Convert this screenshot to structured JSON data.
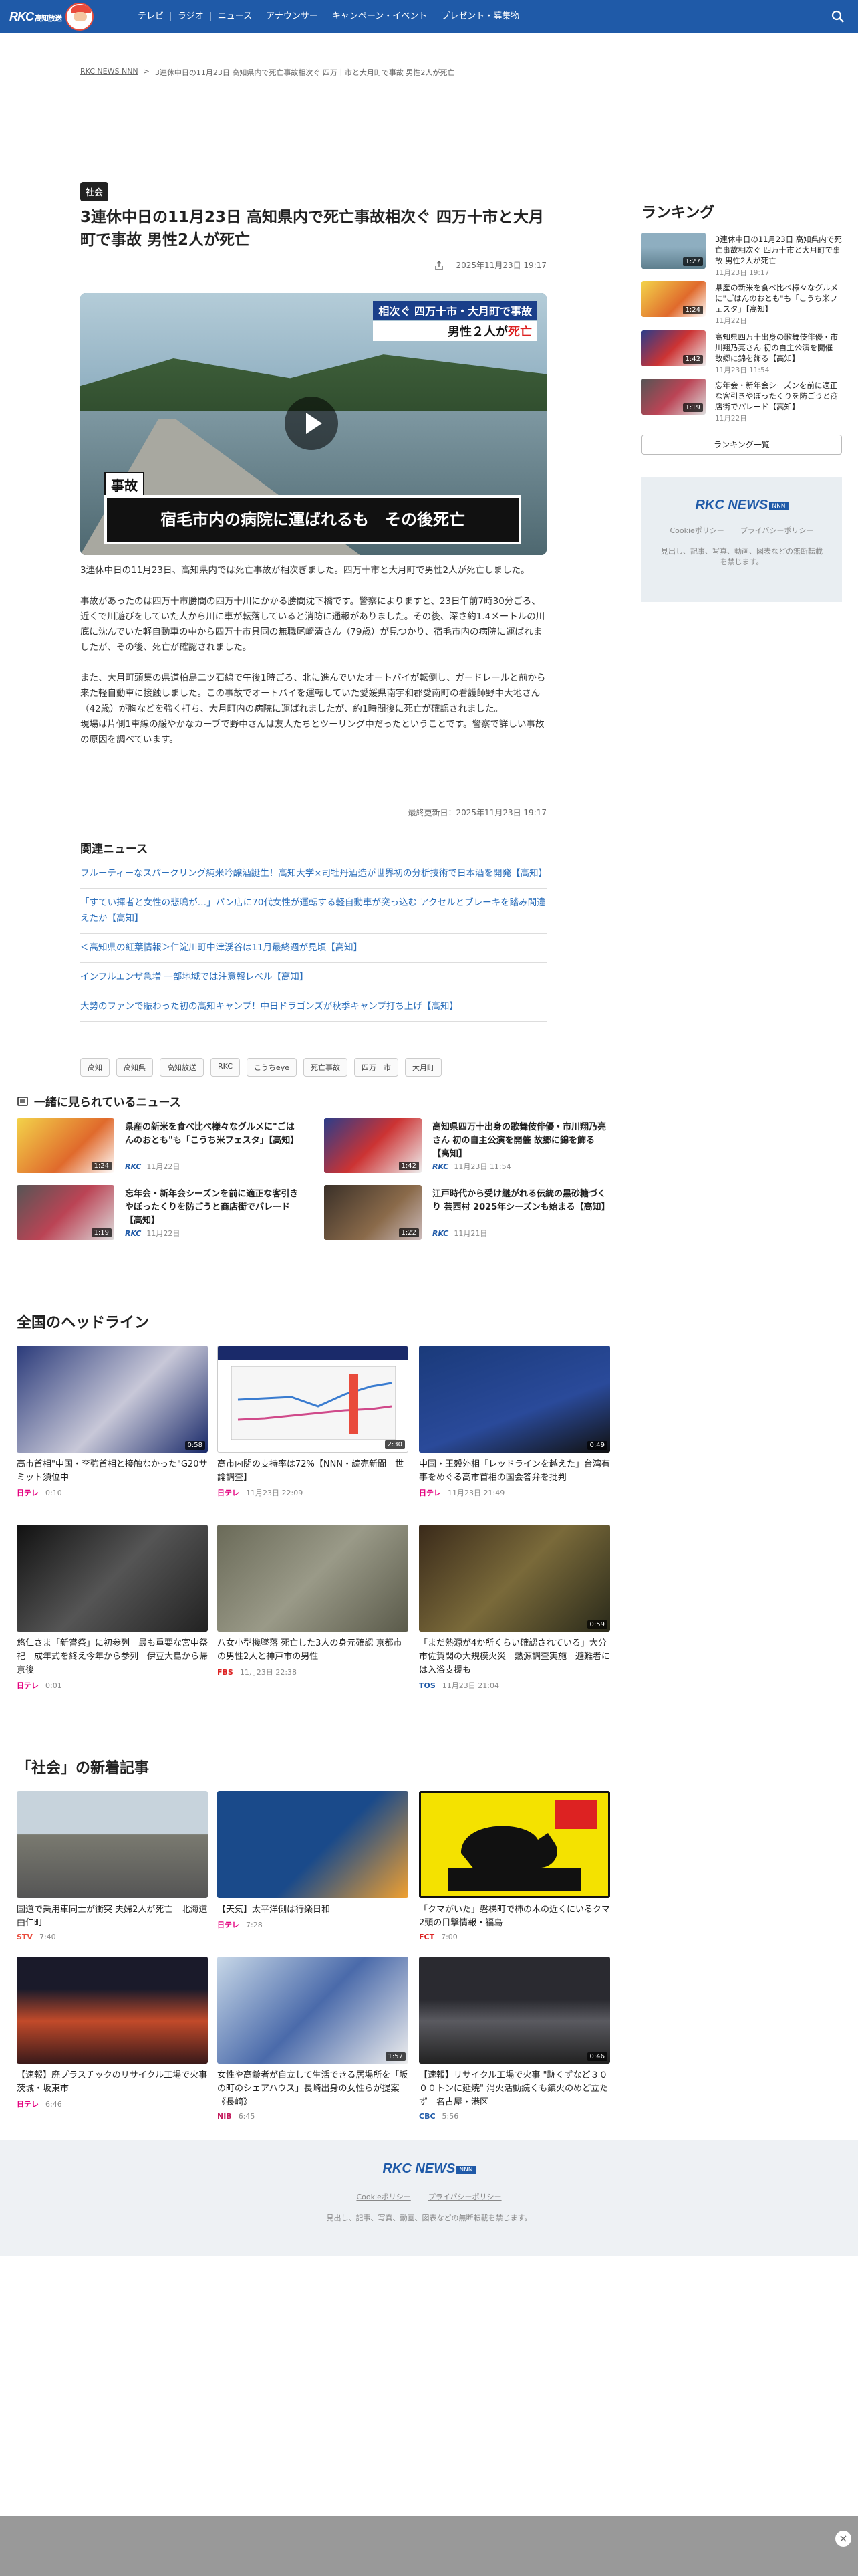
{
  "header": {
    "logo_text": "RKC",
    "logo_sub": "高知放送",
    "nav": [
      "テレビ",
      "ラジオ",
      "ニュース",
      "アナウンサー",
      "キャンペーン・イベント",
      "プレゼント・募集物"
    ]
  },
  "breadcrumb": {
    "home": "RKC NEWS NNN",
    "sep": ">",
    "current": "3連休中日の11月23日 高知県内で死亡事故相次ぐ 四万十市と大月町で事故 男性2人が死亡"
  },
  "article": {
    "category": "社会",
    "title": "3連休中日の11月23日 高知県内で死亡事故相次ぐ 四万十市と大月町で事故 男性2人が死亡",
    "date": "2025年11月23日 19:17",
    "hero": {
      "top_caption": "相次ぐ 四万十市・大月町で事故",
      "top_caption2_pre": "男性２人が",
      "top_caption2_red": "死亡",
      "tag": "事故",
      "main_caption": "宿毛市内の病院に運ばれるも　その後死亡"
    },
    "p1_a": "3連休中日の11月23日、",
    "p1_b": "高知県",
    "p1_c": "内では",
    "p1_d": "死亡事故",
    "p1_e": "が相次ぎました。",
    "p1_f": "四万十市",
    "p1_g": "と",
    "p1_h": "大月町",
    "p1_i": "で男性2人が死亡しました。",
    "p2": "事故があったのは四万十市勝間の四万十川にかかる勝間沈下橋です。警察によりますと、23日午前7時30分ごろ、近くで川遊びをしていた人から川に車が転落していると消防に通報がありました。その後、深さ約1.4メートルの川底に沈んでいた軽自動車の中から四万十市具同の無職尾崎清さん（79歳）が見つかり、宿毛市内の病院に運ばれましたが、その後、死亡が確認されました。",
    "p3": "また、大月町頭集の県道柏島二ツ石線で午後1時ごろ、北に進んでいたオートバイが転倒し、ガードレールと前から来た軽自動車に接触しました。この事故でオートバイを運転していた愛媛県南宇和郡愛南町の看護師野中大地さん（42歳）が胸などを強く打ち、大月町内の病院に運ばれましたが、約1時間後に死亡が確認されました。",
    "p4": "現場は片側1車線の緩やかなカーブで野中さんは友人たちとツーリング中だったということです。警察で詳しい事故の原因を調べています。",
    "updated": "最終更新日：2025年11月23日 19:17"
  },
  "related": {
    "heading": "関連ニュース",
    "items": [
      "フルーティーなスパークリング純米吟醸酒誕生！高知大学×司牡丹酒造が世界初の分析技術で日本酒を開発【高知】",
      "「すてい揮者と女性の悲鳴が…」パン店に70代女性が運転する軽自動車が突っ込む アクセルとブレーキを踏み間違えたか【高知】",
      "＜高知県の紅葉情報＞仁淀川町中津渓谷は11月最終週が見頃【高知】",
      "インフルエンザ急増 一部地域では注意報レベル【高知】",
      "大勢のファンで賑わった初の高知キャンプ！中日ドラゴンズが秋季キャンプ打ち上げ【高知】"
    ]
  },
  "tags": [
    "高知",
    "高知県",
    "高知放送",
    "RKC",
    "こうちeye",
    "死亡事故",
    "四万十市",
    "大月町"
  ],
  "ranking": {
    "heading": "ランキング",
    "items": [
      {
        "title": "3連休中日の11月23日 高知県内で死亡事故相次ぐ 四万十市と大月町で事故 男性2人が死亡",
        "date": "11月23日 19:17",
        "dur": "1:27"
      },
      {
        "title": "県産の新米を食べ比べ様々なグルメに\"ごはんのおとも\"も「こうち米フェスタ」【高知】",
        "date": "11月22日",
        "dur": "1:24"
      },
      {
        "title": "高知県四万十出身の歌舞伎俳優・市川翔乃亮さん 初の自主公演を開催 故郷に錦を飾る【高知】",
        "date": "11月23日 11:54",
        "dur": "1:42"
      },
      {
        "title": "忘年会・新年会シーズンを前に適正な客引きやぼったくりを防ごうと商店街でパレード【高知】",
        "date": "11月22日",
        "dur": "1:19"
      }
    ],
    "more": "ランキング一覧"
  },
  "side_footer": {
    "brand": "RKC NEWS",
    "nnn": "NNN",
    "cookie": "Cookieポリシー",
    "privacy": "プライバシーポリシー",
    "copy": "見出し、記事、写真、動画、図表などの無断転載を禁じます。"
  },
  "together": {
    "heading": "一緒に見られているニュース",
    "items": [
      {
        "title": "県産の新米を食べ比べ様々なグルメに\"ごはんのおとも\"も「こうち米フェスタ」【高知】",
        "src": "RKC",
        "date": "11月22日",
        "dur": "1:24"
      },
      {
        "title": "高知県四万十出身の歌舞伎俳優・市川翔乃亮さん 初の自主公演を開催 故郷に錦を飾る【高知】",
        "src": "RKC",
        "date": "11月23日 11:54",
        "dur": "1:42"
      },
      {
        "title": "忘年会・新年会シーズンを前に適正な客引きやぼったくりを防ごうと商店街でパレード【高知】",
        "src": "RKC",
        "date": "11月22日",
        "dur": "1:19"
      },
      {
        "title": "江戸時代から受け継がれる伝統の黒砂糖づくり 芸西村 2025年シーズンも始まる【高知】",
        "src": "RKC",
        "date": "11月21日",
        "dur": "1:22"
      }
    ]
  },
  "national": {
    "heading": "全国のヘッドライン",
    "items": [
      {
        "title": "高市首相\"中国・李強首相と接触なかった\"G20サミット須位中",
        "src": "日テレ",
        "date": "0:10",
        "dur": "0:58"
      },
      {
        "title": "高市内閣の支持率は72%【NNN・読売新聞　世論調査】",
        "src": "日テレ",
        "date": "11月23日 22:09",
        "dur": "2:30"
      },
      {
        "title": "中国・王毅外相「レッドラインを越えた」台湾有事をめぐる高市首相の国会答弁を批判",
        "src": "日テレ",
        "date": "11月23日 21:49",
        "dur": "0:49"
      },
      {
        "title": "悠仁さま「新嘗祭」に初参列　最も重要な宮中祭祀　成年式を終え今年から参列　伊豆大島から帰京後",
        "src": "日テレ",
        "date": "0:01",
        "dur": ""
      },
      {
        "title": "八女小型機墜落 死亡した3人の身元確認 京都市の男性2人と神戸市の男性",
        "src": "FBS",
        "date": "11月23日 22:38",
        "dur": ""
      },
      {
        "title": "「まだ熱源が4か所くらい確認されている」大分市佐賀関の大規模火災　熱源調査実施　避難者には入浴支援も",
        "src": "TOS",
        "date": "11月23日 21:04",
        "dur": "0:59"
      }
    ]
  },
  "society": {
    "heading": "「社会」の新着記事",
    "items": [
      {
        "title": "国道で乗用車同士が衝突 夫婦2人が死亡　北海道由仁町",
        "src": "STV",
        "date": "7:40",
        "dur": ""
      },
      {
        "title": "【天気】太平洋側は行楽日和",
        "src": "日テレ",
        "date": "7:28",
        "dur": ""
      },
      {
        "title": "「クマがいた」磐梯町で柿の木の近くにいるクマ2頭の目撃情報・福島",
        "src": "FCT",
        "date": "7:00",
        "dur": ""
      },
      {
        "title": "【速報】廃プラスチックのリサイクル工場で火事　茨城・坂東市",
        "src": "日テレ",
        "date": "6:46",
        "dur": ""
      },
      {
        "title": "女性や高齢者が自立して生活できる居場所を「坂の町のシェアハウス」長崎出身の女性らが提案《長崎》",
        "src": "NIB",
        "date": "6:45",
        "dur": "1:57"
      },
      {
        "title": "【速報】リサイクル工場で火事 \"跡くずなど３０００トンに延焼\" 消火活動続くも鎮火のめど立たず　名古屋・港区",
        "src": "CBC",
        "date": "5:56",
        "dur": "0:46"
      }
    ]
  },
  "footer": {
    "brand": "RKC NEWS",
    "nnn": "NNN",
    "cookie": "Cookieポリシー",
    "privacy": "プライバシーポリシー",
    "copy": "見出し、記事、写真、動画、図表などの無断転載を禁じます。"
  },
  "colors": {
    "brand": "#1f5aa8",
    "link": "#2a6ebb",
    "accent_red": "#d22"
  }
}
